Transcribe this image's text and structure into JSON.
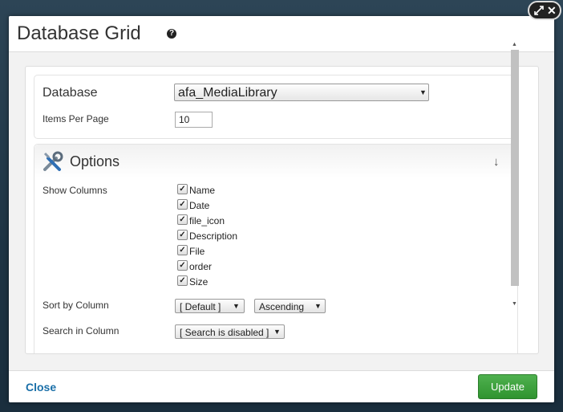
{
  "dialog": {
    "title": "Database Grid",
    "help_icon": "question-circle-icon",
    "window_icons": [
      "resize-icon",
      "close-icon"
    ]
  },
  "general": {
    "database_label": "Database",
    "database_value": "afa_MediaLibrary",
    "items_per_page_label": "Items Per Page",
    "items_per_page_value": "10"
  },
  "options": {
    "title": "Options",
    "icon": "tools-icon",
    "collapse_icon": "arrow-down-icon",
    "show_columns_label": "Show Columns",
    "columns": [
      {
        "label": "Name",
        "checked": true
      },
      {
        "label": "Date",
        "checked": true
      },
      {
        "label": "file_icon",
        "checked": true
      },
      {
        "label": "Description",
        "checked": true
      },
      {
        "label": "File",
        "checked": true
      },
      {
        "label": "order",
        "checked": true
      },
      {
        "label": "Size",
        "checked": true
      }
    ],
    "sort_label": "Sort by Column",
    "sort_column_value": "[ Default ]",
    "sort_order_value": "Ascending",
    "search_label": "Search in Column",
    "search_value": "[ Search is disabled ]"
  },
  "footer": {
    "close_label": "Close",
    "update_label": "Update"
  },
  "colors": {
    "update_button": "#2f932f",
    "close_link": "#1a6fa8",
    "backdrop": "#1e3444"
  }
}
